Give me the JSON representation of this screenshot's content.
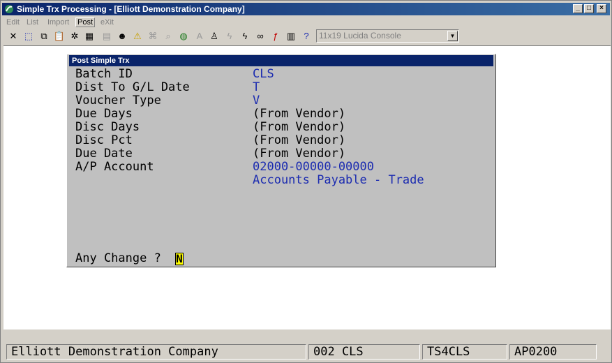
{
  "window": {
    "title": "Simple Trx Processing - [Elliott Demonstration Company]",
    "controls": {
      "minimize": "_",
      "maximize": "□",
      "close": "×"
    }
  },
  "menu": [
    "Edit",
    "List",
    "Import",
    "Post",
    "eXit"
  ],
  "toolbar": {
    "font_selector": "11x19 Lucida Console",
    "icons": [
      "close-icon",
      "select-icon",
      "copy-icon",
      "paste-icon",
      "settings-icon",
      "properties-icon",
      "notes-icon",
      "user-icon",
      "warning-icon",
      "binoculars-icon",
      "zoom-icon",
      "globe-icon",
      "font-icon",
      "person-icon",
      "lightning-icon",
      "lightning-page-icon",
      "link-icon",
      "function-icon",
      "document-icon",
      "help-pointer-icon"
    ]
  },
  "dialog": {
    "title": "Post Simple Trx",
    "fields": [
      {
        "label": "Batch ID",
        "value": "CLS"
      },
      {
        "label": "Dist To G/L Date",
        "value": "T"
      },
      {
        "label": "Voucher Type",
        "value": "V"
      },
      {
        "label": "Due Days",
        "value": "(From Vendor)"
      },
      {
        "label": "Disc Days",
        "value": "(From Vendor)"
      },
      {
        "label": "Disc Pct",
        "value": "(From Vendor)"
      },
      {
        "label": "Due Date",
        "value": "(From Vendor)"
      },
      {
        "label": "A/P Account",
        "value": "02000-00000-00000"
      }
    ],
    "account_description": "Accounts Payable - Trade",
    "prompt": "Any Change ?",
    "answer": "N"
  },
  "status": {
    "company": "Elliott Demonstration Company",
    "batch": "002 CLS",
    "terminal": "TS4CLS",
    "program": "AP0200"
  },
  "colors": {
    "value_text": "#1c2cb0",
    "title_bar": "#0a246a",
    "answer_highlight": "#ffff00"
  }
}
